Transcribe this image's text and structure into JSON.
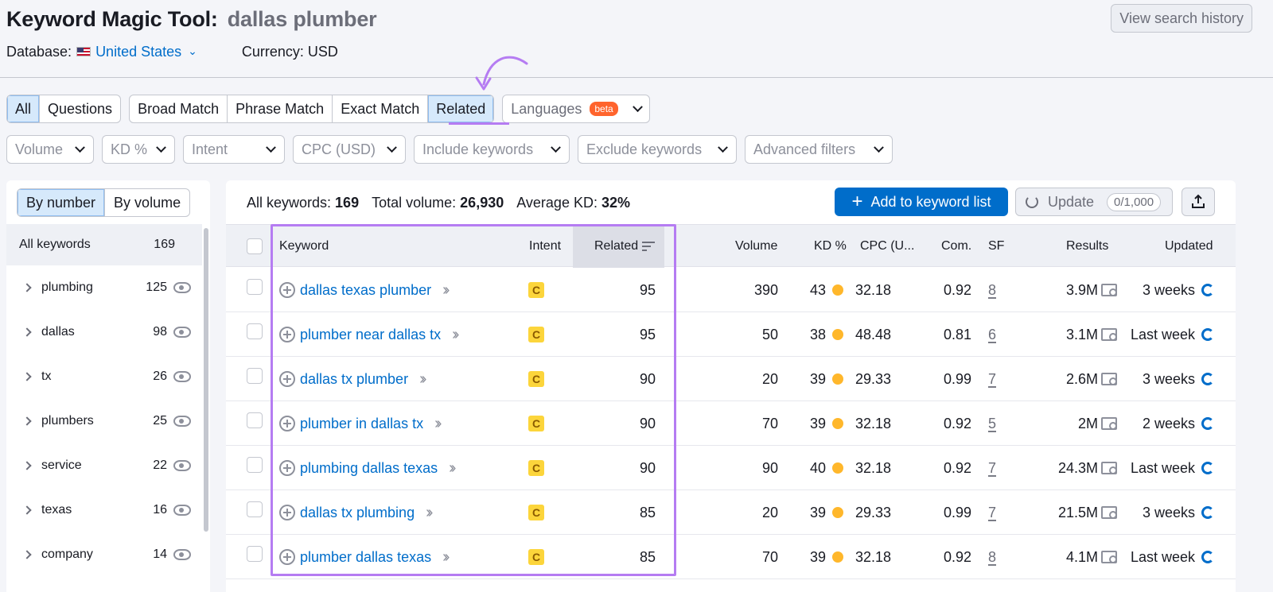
{
  "header": {
    "title": "Keyword Magic Tool:",
    "query": "dallas plumber",
    "history_button": "View search history",
    "database_label": "Database:",
    "database_value": "United States",
    "currency": "Currency: USD"
  },
  "tabs": {
    "group1": [
      "All",
      "Questions"
    ],
    "group2": [
      "Broad Match",
      "Phrase Match",
      "Exact Match",
      "Related"
    ],
    "languages": "Languages",
    "beta": "beta"
  },
  "filters": [
    "Volume",
    "KD %",
    "Intent",
    "CPC (USD)",
    "Include keywords",
    "Exclude keywords",
    "Advanced filters"
  ],
  "left_panel": {
    "toggle": [
      "By number",
      "By volume"
    ],
    "all_label": "All keywords",
    "all_count": "169",
    "groups": [
      {
        "label": "plumbing",
        "count": "125"
      },
      {
        "label": "dallas",
        "count": "98"
      },
      {
        "label": "tx",
        "count": "26"
      },
      {
        "label": "plumbers",
        "count": "25"
      },
      {
        "label": "service",
        "count": "22"
      },
      {
        "label": "texas",
        "count": "16"
      },
      {
        "label": "company",
        "count": "14"
      }
    ]
  },
  "summary": {
    "all_label": "All keywords:",
    "all_value": "169",
    "volume_label": "Total volume:",
    "volume_value": "26,930",
    "kd_label": "Average KD:",
    "kd_value": "32%"
  },
  "actions": {
    "add": "Add to keyword list",
    "update": "Update",
    "update_count": "0/1,000"
  },
  "columns": {
    "keyword": "Keyword",
    "intent": "Intent",
    "related": "Related",
    "volume": "Volume",
    "kd": "KD %",
    "cpc": "CPC (U...",
    "com": "Com.",
    "sf": "SF",
    "results": "Results",
    "updated": "Updated"
  },
  "rows": [
    {
      "keyword": "dallas texas plumber",
      "intent": "C",
      "related": "95",
      "volume": "390",
      "kd": "43",
      "cpc": "32.18",
      "com": "0.92",
      "sf": "8",
      "results": "3.9M",
      "updated": "3 weeks"
    },
    {
      "keyword": "plumber near dallas tx",
      "intent": "C",
      "related": "95",
      "volume": "50",
      "kd": "38",
      "cpc": "48.48",
      "com": "0.81",
      "sf": "6",
      "results": "3.1M",
      "updated": "Last week"
    },
    {
      "keyword": "dallas tx plumber",
      "intent": "C",
      "related": "90",
      "volume": "20",
      "kd": "39",
      "cpc": "29.33",
      "com": "0.99",
      "sf": "7",
      "results": "2.6M",
      "updated": "3 weeks"
    },
    {
      "keyword": "plumber in dallas tx",
      "intent": "C",
      "related": "90",
      "volume": "70",
      "kd": "39",
      "cpc": "32.18",
      "com": "0.92",
      "sf": "5",
      "results": "2M",
      "updated": "2 weeks"
    },
    {
      "keyword": "plumbing dallas texas",
      "intent": "C",
      "related": "90",
      "volume": "90",
      "kd": "40",
      "cpc": "32.18",
      "com": "0.92",
      "sf": "7",
      "results": "24.3M",
      "updated": "Last week"
    },
    {
      "keyword": "dallas tx plumbing",
      "intent": "C",
      "related": "85",
      "volume": "20",
      "kd": "39",
      "cpc": "29.33",
      "com": "0.99",
      "sf": "7",
      "results": "21.5M",
      "updated": "3 weeks"
    },
    {
      "keyword": "plumber dallas texas",
      "intent": "C",
      "related": "85",
      "volume": "70",
      "kd": "39",
      "cpc": "32.18",
      "com": "0.92",
      "sf": "8",
      "results": "4.1M",
      "updated": "Last week"
    }
  ],
  "colors": {
    "accent": "#006dca",
    "highlight": "#b57cf2",
    "intent_commercial": "#fcd53b",
    "kd_medium": "#ffb72b"
  },
  "icons": [
    "flag-us-icon",
    "chevron-down-icon",
    "plus-icon",
    "refresh-icon",
    "export-icon",
    "eye-icon",
    "sort-icon",
    "add-circle-icon",
    "double-chevron-icon",
    "serp-icon",
    "update-icon"
  ]
}
